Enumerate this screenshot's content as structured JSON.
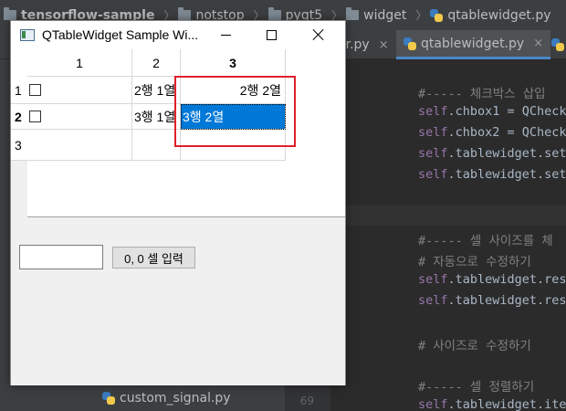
{
  "ide": {
    "breadcrumb": [
      {
        "label": "tensorflow-sample",
        "type": "folder"
      },
      {
        "label": "notstop",
        "type": "folder"
      },
      {
        "label": "pyqt5",
        "type": "folder"
      },
      {
        "label": "widget",
        "type": "folder"
      },
      {
        "label": "qtablewidget.py",
        "type": "file"
      }
    ],
    "tabs": [
      {
        "label": "er.py",
        "close": "×"
      },
      {
        "label": "qtablewidget.py",
        "close": "×"
      }
    ],
    "project_file": "custom_signal.py",
    "line_number": "69",
    "code_lines": [
      {
        "kind": "comment",
        "text": "#----- 체크박스 삽입"
      },
      {
        "kind": "code",
        "self": "self",
        "rest": ".chbox1 = QCheck"
      },
      {
        "kind": "code",
        "self": "self",
        "rest": ".chbox2 = QCheck"
      },
      {
        "kind": "code",
        "self": "self",
        "rest": ".tablewidget.set"
      },
      {
        "kind": "code",
        "self": "self",
        "rest": ".tablewidget.set"
      },
      {
        "kind": "comment",
        "text": "#----- 셀 사이즈를 체"
      },
      {
        "kind": "comment",
        "text": "# 자동으로 수정하기"
      },
      {
        "kind": "code",
        "self": "self",
        "rest": ".tablewidget.res"
      },
      {
        "kind": "code",
        "self": "self",
        "rest": ".tablewidget.res"
      },
      {
        "kind": "comment",
        "text": "# 사이즈로 수정하기"
      },
      {
        "kind": "comment",
        "text": "#----- 셀 정렬하기"
      },
      {
        "kind": "code",
        "self": "self",
        "rest": ".tablewidget.ite"
      }
    ]
  },
  "window": {
    "title": "QTableWidget Sample Wi...",
    "icons": {
      "app": "window-icon",
      "minimize": "minimize-icon",
      "maximize": "maximize-icon",
      "close": "close-icon"
    }
  },
  "table": {
    "column_headers": [
      "1",
      "2",
      "3"
    ],
    "row_headers": [
      "1",
      "2",
      "3"
    ],
    "rows": [
      [
        "",
        "2행 1열",
        "2행 2열"
      ],
      [
        "",
        "3행 1열",
        "3행 2열"
      ],
      [
        "",
        "",
        ""
      ]
    ],
    "checkboxes": [
      "unchecked",
      "unchecked"
    ],
    "current_row": "2",
    "current_col": "3"
  },
  "controls": {
    "input_value": "",
    "button_label": "0, 0 셀 입력"
  },
  "colors": {
    "selection": "#0078d7",
    "highlight_box": "#e0202a"
  }
}
